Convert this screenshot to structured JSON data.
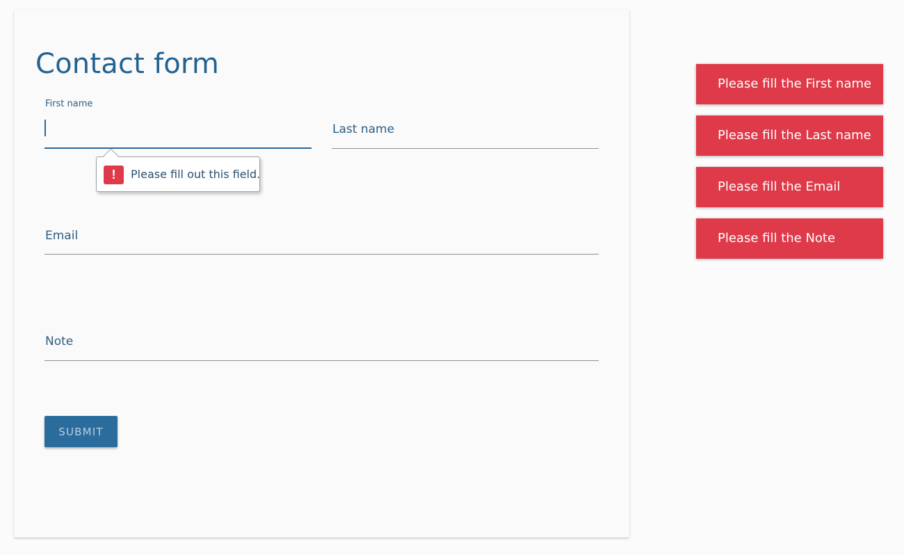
{
  "form": {
    "title": "Contact form",
    "fields": [
      {
        "label": "First name",
        "value": ""
      },
      {
        "label": "Last name",
        "value": ""
      },
      {
        "label": "Email",
        "value": ""
      },
      {
        "label": "Note",
        "value": ""
      }
    ],
    "validation_tooltip": "Please fill out this field.",
    "submit_label": "SUBMIT"
  },
  "toasts": [
    "Please fill the First name",
    "Please fill the Last name",
    "Please fill the Email",
    "Please fill the Note"
  ],
  "colors": {
    "accent": "#2a6496",
    "error": "#de3a49",
    "title": "#23628f"
  },
  "icons": {
    "tooltip": "exclamation-warning-icon"
  }
}
